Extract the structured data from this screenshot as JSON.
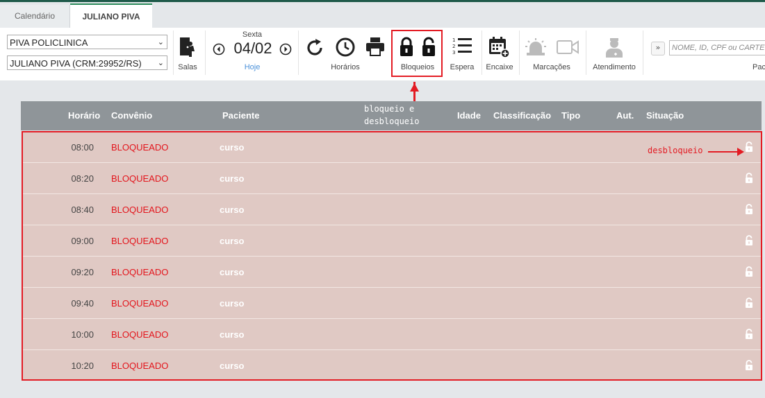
{
  "tabs": [
    "Calendário",
    "JULIANO PIVA"
  ],
  "toolbar": {
    "clinic_select": "PIVA POLICLINICA",
    "doctor_select": "JULIANO PIVA (CRM:29952/RS)",
    "salas_label": "Salas",
    "weekday": "Sexta",
    "date": "04/02",
    "today_label": "Hoje",
    "horarios_label": "Horários",
    "bloqueios_label": "Bloqueios",
    "espera_label": "Espera",
    "encaixe_label": "Encaixe",
    "marcacoes_label": "Marcações",
    "atendimento_label": "Atendimento",
    "expand_label": "»",
    "search_placeholder": "NOME, ID, CPF ou CARTEIRA",
    "search_label_partial": "Pac"
  },
  "annotations": {
    "top_line1": "bloqueio e",
    "top_line2": "desbloqueio",
    "side": "desbloqueio"
  },
  "table": {
    "headers": [
      "Horário",
      "Convênio",
      "Paciente",
      "Idade",
      "Classificação",
      "Tipo",
      "Aut.",
      "Situação"
    ],
    "rows": [
      {
        "time": "08:00",
        "convenio": "BLOQUEADO",
        "paciente": "curso"
      },
      {
        "time": "08:20",
        "convenio": "BLOQUEADO",
        "paciente": "curso"
      },
      {
        "time": "08:40",
        "convenio": "BLOQUEADO",
        "paciente": "curso"
      },
      {
        "time": "09:00",
        "convenio": "BLOQUEADO",
        "paciente": "curso"
      },
      {
        "time": "09:20",
        "convenio": "BLOQUEADO",
        "paciente": "curso"
      },
      {
        "time": "09:40",
        "convenio": "BLOQUEADO",
        "paciente": "curso"
      },
      {
        "time": "10:00",
        "convenio": "BLOQUEADO",
        "paciente": "curso"
      },
      {
        "time": "10:20",
        "convenio": "BLOQUEADO",
        "paciente": "curso"
      }
    ]
  },
  "colors": {
    "highlight": "#e31b23",
    "blocked_text": "#e3141b",
    "row_bg": "#e0c9c4",
    "header_bg": "#8f9599"
  },
  "icons": [
    "salas-icon",
    "prev-day-icon",
    "next-day-icon",
    "refresh-icon",
    "clock-icon",
    "print-icon",
    "lock-icon",
    "unlock-icon",
    "list-icon",
    "calendar-add-icon",
    "alarm-icon",
    "video-icon",
    "doctor-icon",
    "unlock-row-icon"
  ]
}
